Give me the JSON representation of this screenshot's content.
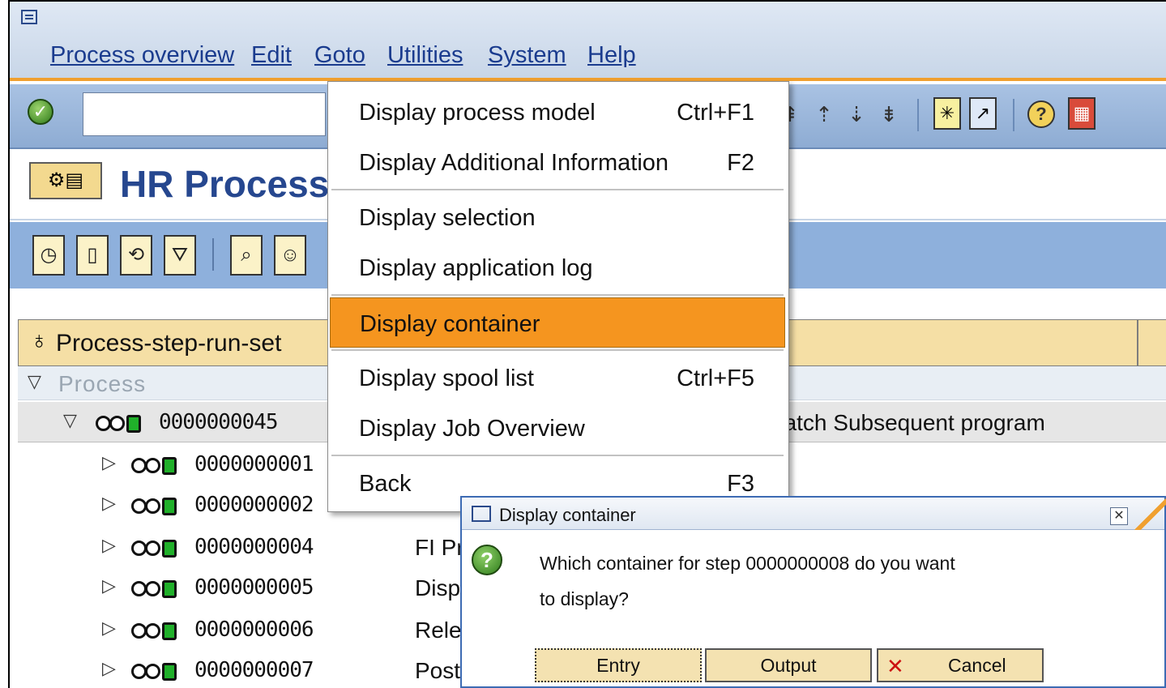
{
  "menubar": {
    "items": [
      "Process overview",
      "Edit",
      "Goto",
      "Utilities",
      "System",
      "Help"
    ]
  },
  "page": {
    "title": "HR Process"
  },
  "tree": {
    "header": "Process-step-run-set",
    "column": "Process",
    "parent": {
      "id": "0000000045",
      "text": "batch Subsequent program"
    },
    "rows": [
      {
        "id": "0000000001",
        "text": ""
      },
      {
        "id": "0000000002",
        "text": ""
      },
      {
        "id": "0000000004",
        "text": "FI Pr"
      },
      {
        "id": "0000000005",
        "text": "Disp"
      },
      {
        "id": "0000000006",
        "text": "Rele"
      },
      {
        "id": "0000000007",
        "text": "Post"
      }
    ]
  },
  "goto_menu": {
    "items": [
      {
        "label": "Display process model",
        "shortcut": "Ctrl+F1"
      },
      {
        "label": "Display Additional Information",
        "shortcut": "F2"
      },
      {
        "label": "Display selection",
        "shortcut": ""
      },
      {
        "label": "Display application log",
        "shortcut": ""
      },
      {
        "label": "Display container",
        "shortcut": ""
      },
      {
        "label": "Display spool list",
        "shortcut": "Ctrl+F5"
      },
      {
        "label": "Display Job Overview",
        "shortcut": ""
      },
      {
        "label": "Back",
        "shortcut": "F3"
      }
    ],
    "highlighted": "Display container"
  },
  "dialog": {
    "title": "Display container",
    "message_line1": "Which container for step 0000000008 do you want",
    "message_line2": "to display?",
    "buttons": {
      "entry": "Entry",
      "output": "Output",
      "cancel": "Cancel"
    }
  },
  "colors": {
    "menu_highlight": "#f5951f",
    "accent_orange": "#f0a030",
    "title_blue": "#26478f",
    "status_green": "#20b02a"
  }
}
